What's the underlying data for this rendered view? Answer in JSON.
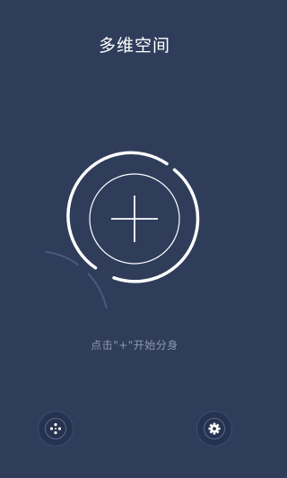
{
  "app": {
    "title": "多维空间"
  },
  "main": {
    "hint_text": "点击\"+\"开始分身"
  },
  "bottom_bar": {
    "left_icon": "apps-cluster-icon",
    "right_icon": "gear-icon"
  },
  "colors": {
    "background": "#2f3d5b",
    "accent": "#ffffff",
    "outer_ring": "#4a5a7a",
    "hint": "#8c98ad"
  }
}
